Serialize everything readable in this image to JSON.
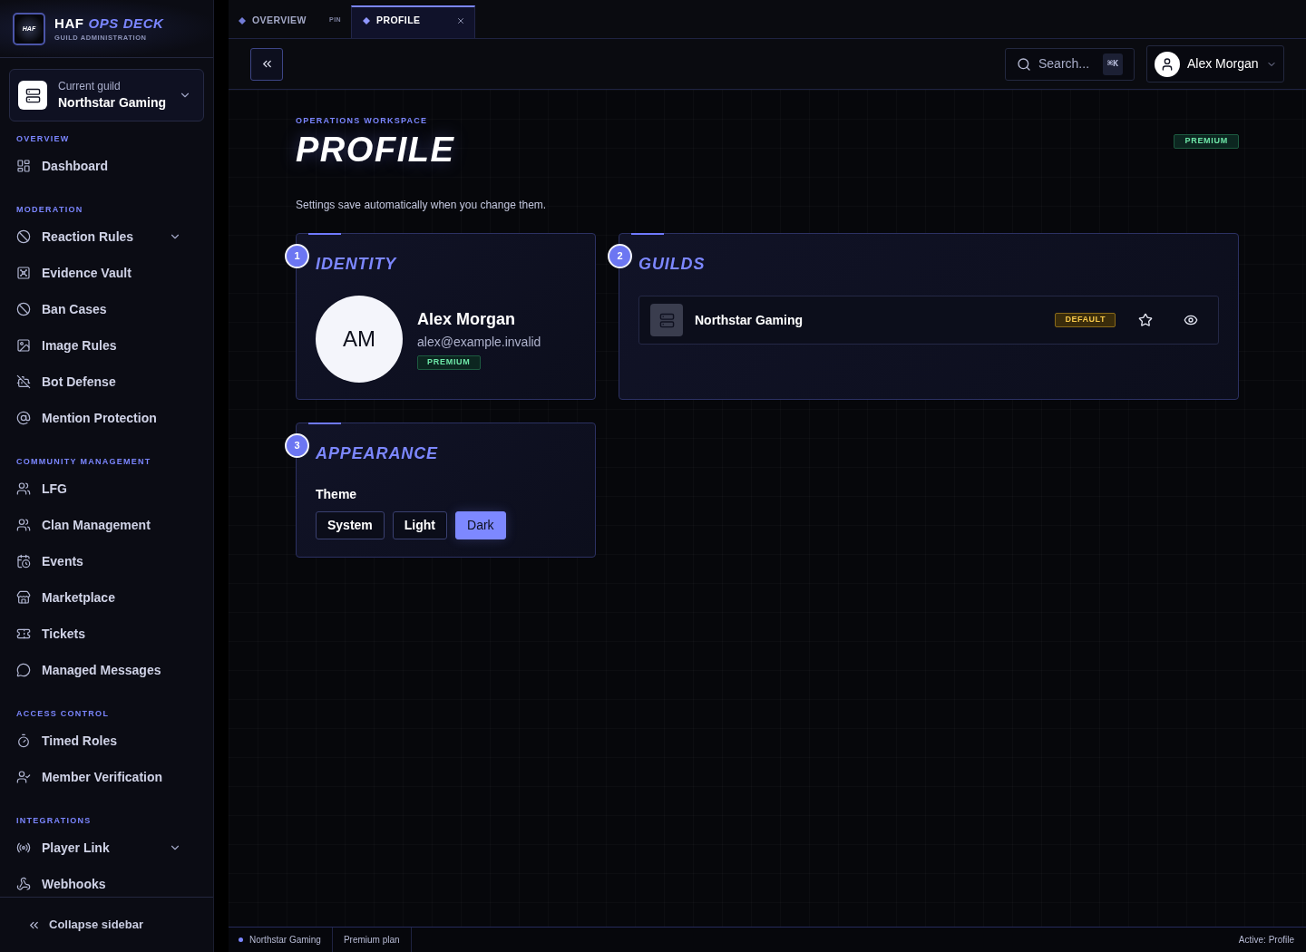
{
  "sidebar": {
    "brand": {
      "logo_text": "HAF",
      "title": "HAF *OPS DECK*",
      "subtitle": "GUILD ADMINISTRATION"
    },
    "guild_picker": {
      "label": "Current guild",
      "value": "Northstar Gaming"
    },
    "sections": [
      {
        "heading": "OVERVIEW",
        "items": [
          {
            "label": "Dashboard",
            "expandable": false
          }
        ]
      },
      {
        "heading": "MODERATION",
        "items": [
          {
            "label": "Reaction Rules",
            "expandable": true
          },
          {
            "label": "Evidence Vault",
            "expandable": false
          },
          {
            "label": "Ban Cases",
            "expandable": false
          },
          {
            "label": "Image Rules",
            "expandable": false
          },
          {
            "label": "Bot Defense",
            "expandable": false
          },
          {
            "label": "Mention Protection",
            "expandable": false
          }
        ]
      },
      {
        "heading": "COMMUNITY MANAGEMENT",
        "items": [
          {
            "label": "LFG",
            "expandable": false
          },
          {
            "label": "Clan Management",
            "expandable": false
          },
          {
            "label": "Events",
            "expandable": false
          },
          {
            "label": "Marketplace",
            "expandable": false
          },
          {
            "label": "Tickets",
            "expandable": false
          },
          {
            "label": "Managed Messages",
            "expandable": false
          }
        ]
      },
      {
        "heading": "ACCESS CONTROL",
        "items": [
          {
            "label": "Timed Roles",
            "expandable": false
          },
          {
            "label": "Member Verification",
            "expandable": false
          }
        ]
      },
      {
        "heading": "INTEGRATIONS",
        "items": [
          {
            "label": "Player Link",
            "expandable": true
          },
          {
            "label": "Webhooks",
            "expandable": false
          }
        ]
      }
    ],
    "collapse_label": "Collapse sidebar"
  },
  "tabs": [
    {
      "label": "OVERVIEW",
      "selected": false,
      "pin_label": "PIN",
      "closable": false
    },
    {
      "label": "PROFILE",
      "selected": true,
      "closable": true
    }
  ],
  "toolbar": {
    "search": {
      "placeholder": "Search...",
      "shortcut": "⌘K"
    },
    "user": {
      "name": "Alex Morgan"
    }
  },
  "page": {
    "eyebrow": "OPERATIONS WORKSPACE",
    "title": "PROFILE",
    "plan_badge": "PREMIUM",
    "description": "Settings save automatically when you change them."
  },
  "cards": [
    {
      "kind": "identity",
      "number": "1",
      "title": "IDENTITY",
      "avatar_initials": "AM",
      "name": "Alex Morgan",
      "email": "alex@example.invalid",
      "badge": "PREMIUM"
    },
    {
      "kind": "guilds",
      "number": "2",
      "title": "GUILDS",
      "guilds": [
        {
          "name": "Northstar Gaming",
          "badge": "DEFAULT",
          "starred": false
        }
      ]
    },
    {
      "kind": "appearance",
      "number": "3",
      "title": "APPEARANCE",
      "label": "Theme",
      "options": [
        {
          "label": "System",
          "selected": false
        },
        {
          "label": "Light",
          "selected": false
        },
        {
          "label": "Dark",
          "selected": true
        }
      ]
    }
  ],
  "status_bar": {
    "items": [
      {
        "label": "Northstar Gaming",
        "dot": true
      },
      {
        "label": "Premium plan",
        "dot": false
      }
    ],
    "active": "Active: Profile"
  }
}
